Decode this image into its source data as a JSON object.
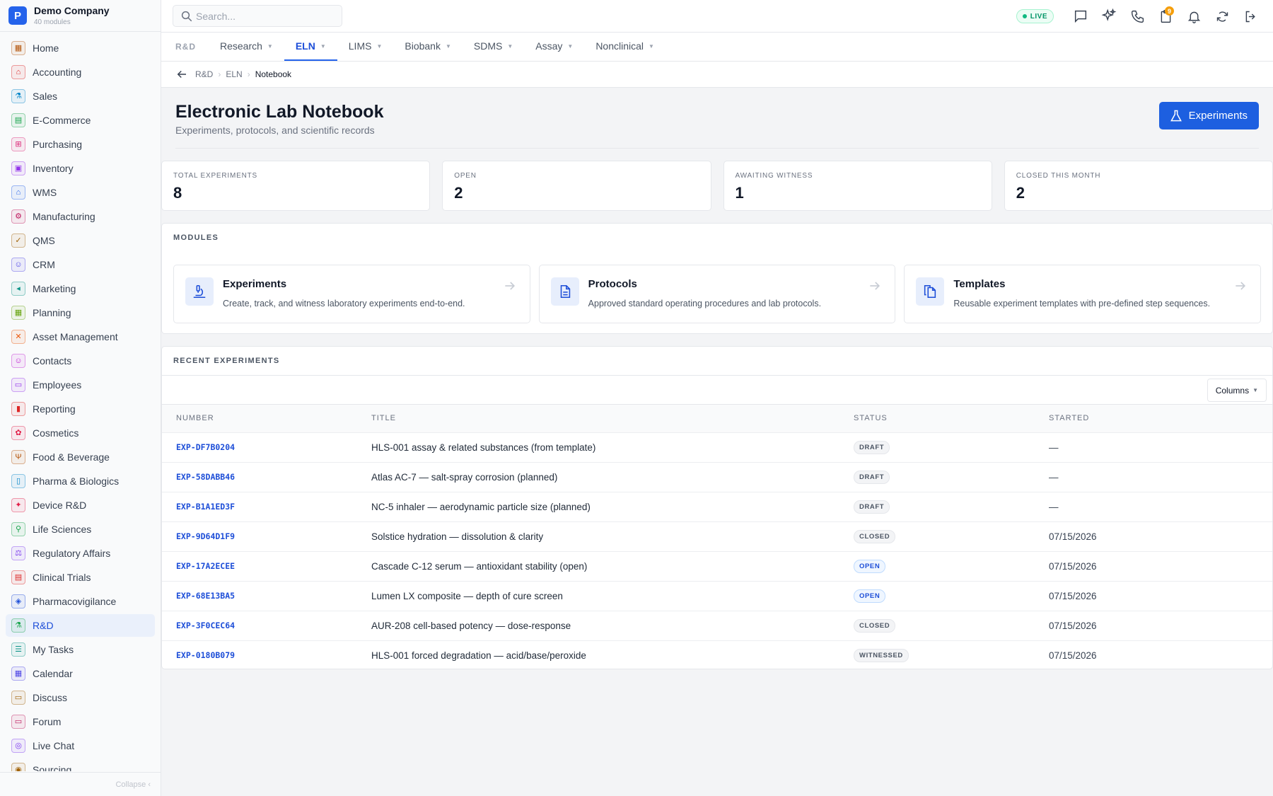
{
  "brand": {
    "logo_letter": "P",
    "name": "Demo Company",
    "subtitle": "40 modules"
  },
  "sidebar": {
    "items": [
      {
        "label": "Home",
        "icon": "grid-icon",
        "color": "#b45309",
        "glyph": "▦"
      },
      {
        "label": "Accounting",
        "icon": "bank-icon",
        "color": "#dc2626",
        "glyph": "⌂"
      },
      {
        "label": "Sales",
        "icon": "flask-icon",
        "color": "#0284c7",
        "glyph": "⚗"
      },
      {
        "label": "E-Commerce",
        "icon": "store-icon",
        "color": "#16a34a",
        "glyph": "▤"
      },
      {
        "label": "Purchasing",
        "icon": "cart-icon",
        "color": "#db2777",
        "glyph": "⊞"
      },
      {
        "label": "Inventory",
        "icon": "box-icon",
        "color": "#9333ea",
        "glyph": "▣"
      },
      {
        "label": "WMS",
        "icon": "warehouse-icon",
        "color": "#2563eb",
        "glyph": "⌂"
      },
      {
        "label": "Manufacturing",
        "icon": "factory-icon",
        "color": "#be185d",
        "glyph": "⚙"
      },
      {
        "label": "QMS",
        "icon": "badge-check-icon",
        "color": "#a16207",
        "glyph": "✓"
      },
      {
        "label": "CRM",
        "icon": "users-icon",
        "color": "#4f46e5",
        "glyph": "☺"
      },
      {
        "label": "Marketing",
        "icon": "megaphone-icon",
        "color": "#0d9488",
        "glyph": "◂"
      },
      {
        "label": "Planning",
        "icon": "calendar-icon",
        "color": "#65a30d",
        "glyph": "▦"
      },
      {
        "label": "Asset Management",
        "icon": "tools-icon",
        "color": "#ea580c",
        "glyph": "✕"
      },
      {
        "label": "Contacts",
        "icon": "contact-icon",
        "color": "#c026d3",
        "glyph": "☺"
      },
      {
        "label": "Employees",
        "icon": "id-card-icon",
        "color": "#9333ea",
        "glyph": "▭"
      },
      {
        "label": "Reporting",
        "icon": "bar-chart-icon",
        "color": "#dc2626",
        "glyph": "▮"
      },
      {
        "label": "Cosmetics",
        "icon": "lotus-icon",
        "color": "#e11d48",
        "glyph": "✿"
      },
      {
        "label": "Food & Beverage",
        "icon": "utensils-icon",
        "color": "#b45309",
        "glyph": "Ψ"
      },
      {
        "label": "Pharma & Biologics",
        "icon": "pill-icon",
        "color": "#0284c7",
        "glyph": "▯"
      },
      {
        "label": "Device R&D",
        "icon": "cpu-icon",
        "color": "#e11d48",
        "glyph": "✦"
      },
      {
        "label": "Life Sciences",
        "icon": "microscope-icon",
        "color": "#16a34a",
        "glyph": "⚲"
      },
      {
        "label": "Regulatory Affairs",
        "icon": "gavel-icon",
        "color": "#7c3aed",
        "glyph": "⚖"
      },
      {
        "label": "Clinical Trials",
        "icon": "clipboard-icon",
        "color": "#dc2626",
        "glyph": "▤"
      },
      {
        "label": "Pharmacovigilance",
        "icon": "shield-icon",
        "color": "#1d4ed8",
        "glyph": "◈"
      },
      {
        "label": "R&D",
        "icon": "flask-icon",
        "color": "#16a34a",
        "glyph": "⚗",
        "active": true
      },
      {
        "label": "My Tasks",
        "icon": "checklist-icon",
        "color": "#0d9488",
        "glyph": "☰"
      },
      {
        "label": "Calendar",
        "icon": "calendar-icon",
        "color": "#4f46e5",
        "glyph": "▦"
      },
      {
        "label": "Discuss",
        "icon": "chat-icon",
        "color": "#a16207",
        "glyph": "▭"
      },
      {
        "label": "Forum",
        "icon": "messages-icon",
        "color": "#be185d",
        "glyph": "▭"
      },
      {
        "label": "Live Chat",
        "icon": "headset-icon",
        "color": "#7c3aed",
        "glyph": "◎"
      },
      {
        "label": "Sourcing",
        "icon": "sourcing-icon",
        "color": "#a16207",
        "glyph": "◉"
      }
    ],
    "collapse_label": "Collapse ‹"
  },
  "topbar": {
    "search_placeholder": "Search...",
    "live_label": "LIVE",
    "notification_count": "9",
    "icons": [
      "chat-icon",
      "sparkles-icon",
      "phone-icon",
      "clipboard-badge-icon",
      "bell-icon",
      "refresh-icon",
      "logout-icon"
    ]
  },
  "module_tabs": {
    "prefix": "R&D",
    "tabs": [
      {
        "label": "Research"
      },
      {
        "label": "ELN",
        "active": true
      },
      {
        "label": "LIMS"
      },
      {
        "label": "Biobank"
      },
      {
        "label": "SDMS"
      },
      {
        "label": "Assay"
      },
      {
        "label": "Nonclinical"
      }
    ]
  },
  "breadcrumb": {
    "items": [
      "R&D",
      "ELN"
    ],
    "current": "Notebook"
  },
  "page": {
    "title": "Electronic Lab Notebook",
    "subtitle": "Experiments, protocols, and scientific records",
    "primary_button": "Experiments"
  },
  "stats": [
    {
      "label": "TOTAL EXPERIMENTS",
      "value": "8"
    },
    {
      "label": "OPEN",
      "value": "2"
    },
    {
      "label": "AWAITING WITNESS",
      "value": "1"
    },
    {
      "label": "CLOSED THIS MONTH",
      "value": "2"
    }
  ],
  "modules": {
    "title": "MODULES",
    "cards": [
      {
        "name": "Experiments",
        "desc": "Create, track, and witness laboratory experiments end-to-end.",
        "icon": "microscope-icon"
      },
      {
        "name": "Protocols",
        "desc": "Approved standard operating procedures and lab protocols.",
        "icon": "document-icon"
      },
      {
        "name": "Templates",
        "desc": "Reusable experiment templates with pre-defined step sequences.",
        "icon": "copy-icon"
      }
    ]
  },
  "recent": {
    "title": "RECENT EXPERIMENTS",
    "columns_button": "Columns",
    "headers": [
      "NUMBER",
      "TITLE",
      "STATUS",
      "STARTED"
    ],
    "rows": [
      {
        "number": "EXP-DF7B0204",
        "title": "HLS-001 assay & related substances (from template)",
        "status": "DRAFT",
        "started": "—"
      },
      {
        "number": "EXP-58DABB46",
        "title": "Atlas AC-7 — salt-spray corrosion (planned)",
        "status": "DRAFT",
        "started": "—"
      },
      {
        "number": "EXP-B1A1ED3F",
        "title": "NC-5 inhaler — aerodynamic particle size (planned)",
        "status": "DRAFT",
        "started": "—"
      },
      {
        "number": "EXP-9D64D1F9",
        "title": "Solstice hydration — dissolution & clarity",
        "status": "CLOSED",
        "started": "07/15/2026"
      },
      {
        "number": "EXP-17A2ECEE",
        "title": "Cascade C-12 serum — antioxidant stability (open)",
        "status": "OPEN",
        "started": "07/15/2026"
      },
      {
        "number": "EXP-68E13BA5",
        "title": "Lumen LX composite — depth of cure screen",
        "status": "OPEN",
        "started": "07/15/2026"
      },
      {
        "number": "EXP-3F0CEC64",
        "title": "AUR-208 cell-based potency — dose-response",
        "status": "CLOSED",
        "started": "07/15/2026"
      },
      {
        "number": "EXP-0180B079",
        "title": "HLS-001 forced degradation — acid/base/peroxide",
        "status": "WITNESSED",
        "started": "07/15/2026"
      }
    ]
  }
}
